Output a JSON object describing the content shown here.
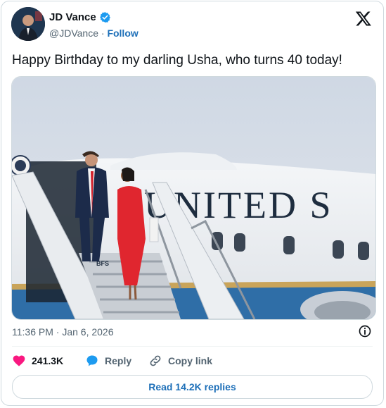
{
  "author": {
    "name": "JD Vance",
    "handle": "@JDVance",
    "separator": "·",
    "follow_label": "Follow"
  },
  "tweet": {
    "text": "Happy Birthday to my darling Usha, who turns 40 today!",
    "image_text": "UNITED S",
    "image_stair_label": "BFS",
    "timestamp": "11:36 PM · Jan 6, 2026"
  },
  "actions": {
    "like_count": "241.3K",
    "reply_label": "Reply",
    "copy_link_label": "Copy link"
  },
  "replies_button": "Read 14.2K replies",
  "colors": {
    "link_blue": "#1d6fb8",
    "like_pink": "#f91880",
    "verified_blue": "#1d9bf0",
    "text_gray": "#536471"
  }
}
